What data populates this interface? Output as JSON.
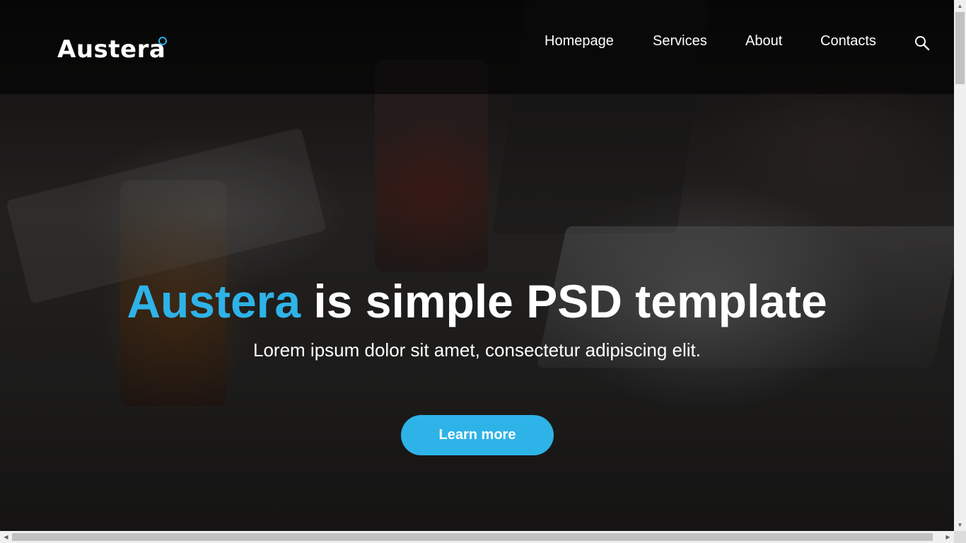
{
  "brand": {
    "logo_text": "Austera",
    "accent_color": "#2eb3e8"
  },
  "nav": {
    "items": [
      {
        "label": "Homepage"
      },
      {
        "label": "Services"
      },
      {
        "label": "About"
      },
      {
        "label": "Contacts"
      }
    ],
    "search_icon": "search-icon"
  },
  "hero": {
    "title_accent": "Austera",
    "title_rest": " is simple PSD template",
    "subtitle": "Lorem ipsum dolor sit amet, consectetur adipiscing elit.",
    "cta_label": "Learn more"
  },
  "scrollbars": {
    "up_icon": "arrow-up-icon",
    "down_icon": "arrow-down-icon",
    "left_icon": "arrow-left-icon",
    "right_icon": "arrow-right-icon"
  }
}
